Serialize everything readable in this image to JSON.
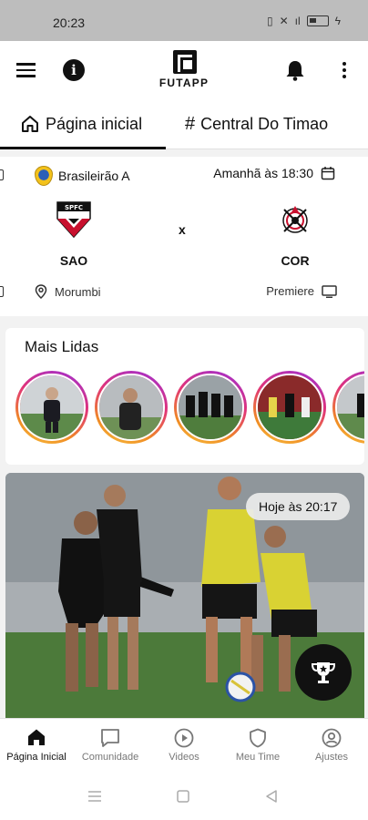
{
  "status_bar": {
    "time": "20:23",
    "icons": [
      "vibrate-icon",
      "no-signal-icon",
      "wifi-icon",
      "battery-icon"
    ]
  },
  "app_bar": {
    "logo_text": "FUTAPP"
  },
  "tabs": [
    {
      "label": "Página inicial",
      "icon": "home-icon",
      "active": true
    },
    {
      "label": "Central Do Timao",
      "icon": "hash-icon",
      "active": false
    }
  ],
  "match": {
    "league": "Brasileirão A",
    "kickoff": "Amanhã às 18:30",
    "home_team": "SAO",
    "away_team": "COR",
    "versus": "x",
    "venue": "Morumbi",
    "broadcast": "Premiere"
  },
  "mais_lidas": {
    "title": "Mais Lidas",
    "stories": [
      {
        "name": "story-1"
      },
      {
        "name": "story-2"
      },
      {
        "name": "story-3"
      },
      {
        "name": "story-4"
      },
      {
        "name": "story-5"
      }
    ]
  },
  "news": {
    "time_chip": "Hoje às 20:17"
  },
  "bottom_nav": [
    {
      "label": "Página Inicial",
      "icon": "home-icon",
      "active": true
    },
    {
      "label": "Comunidade",
      "icon": "chat-icon",
      "active": false
    },
    {
      "label": "Videos",
      "icon": "play-icon",
      "active": false
    },
    {
      "label": "Meu Time",
      "icon": "shield-icon",
      "active": false
    },
    {
      "label": "Ajustes",
      "icon": "user-icon",
      "active": false
    }
  ],
  "colors": {
    "accent": "#111111",
    "nav_inactive": "#777777",
    "story_ring": "#e0337a"
  }
}
